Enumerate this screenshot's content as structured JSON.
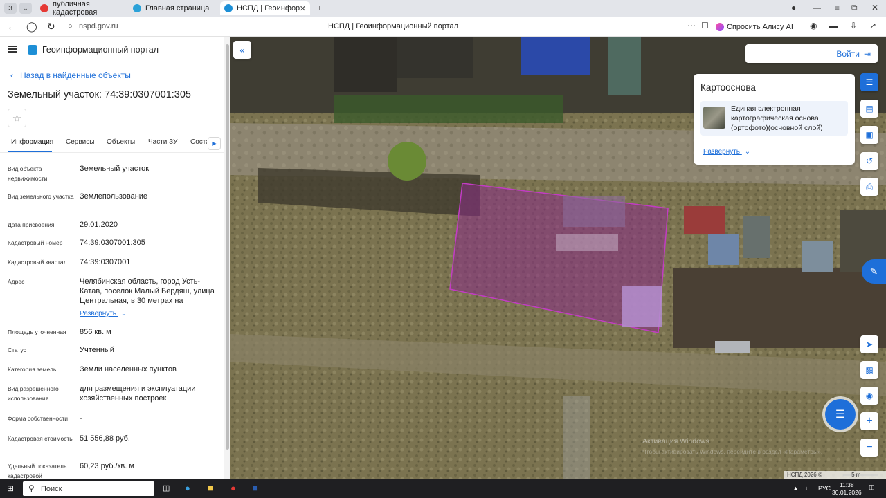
{
  "browser": {
    "tab_count": "3",
    "tabs": [
      {
        "label": "публичная кадастровая"
      },
      {
        "label": "Главная страница"
      },
      {
        "label": "НСПД | Геоинформаци"
      }
    ],
    "url": "nspd.gov.ru",
    "page_title": "НСПД | Геоинформационный портал",
    "alice_label": "Спросить Алису AI"
  },
  "panel": {
    "app_title": "Геоинформационный портал",
    "back_label": "Назад в найденные объекты",
    "object_title": "Земельный участок: 74:39:0307001:305",
    "tabs": [
      "Информация",
      "Сервисы",
      "Объекты",
      "Части ЗУ",
      "Соста"
    ],
    "rows": [
      {
        "label": "Вид объекта недвижимости",
        "value": "Земельный участок"
      },
      {
        "label": "Вид земельного участка",
        "value": "Землепользование"
      },
      {
        "label": "Дата присвоения",
        "value": "29.01.2020"
      },
      {
        "label": "Кадастровый номер",
        "value": "74:39:0307001:305"
      },
      {
        "label": "Кадастровый квартал",
        "value": "74:39:0307001"
      },
      {
        "label": "Адрес",
        "value": "Челябинская область, город Усть-Катав, поселок Малый Бердяш, улица Центральная, в 30 метрах на"
      },
      {
        "label": "Площадь уточненная",
        "value": "856 кв. м"
      },
      {
        "label": "Статус",
        "value": "Учтенный"
      },
      {
        "label": "Категория земель",
        "value": "Земли населенных пунктов"
      },
      {
        "label": "Вид разрешенного использования",
        "value": "для размещения и эксплуатации хозяйственных построек"
      },
      {
        "label": "Форма собственности",
        "value": "-"
      },
      {
        "label": "Кадастровая стоимость",
        "value": "51 556,88 руб."
      },
      {
        "label": "Удельный показатель кадастровой",
        "value": "60,23 руб./кв. м"
      }
    ],
    "expand_label": "Развернуть"
  },
  "map": {
    "login_label": "Войти",
    "basemap": {
      "heading": "Картооснова",
      "layer": "Единая электронная картографическая основа (ортофото)(основной слой)",
      "expand_label": "Развернуть"
    },
    "scale": "5 m",
    "copyright": "НСПД 2026 ©",
    "watermark": "Активация Windows",
    "watermark_sub": "Чтобы активировать Windows, перейдите в раздел «Параметры»."
  },
  "taskbar": {
    "search_placeholder": "Поиск",
    "lang": "РУС",
    "time": "11:38",
    "date": "30.01.2026"
  },
  "colors": {
    "accent": "#1e6fd9",
    "parcel_fill": "#8a2b86",
    "parcel_stroke": "#c23cc4"
  }
}
